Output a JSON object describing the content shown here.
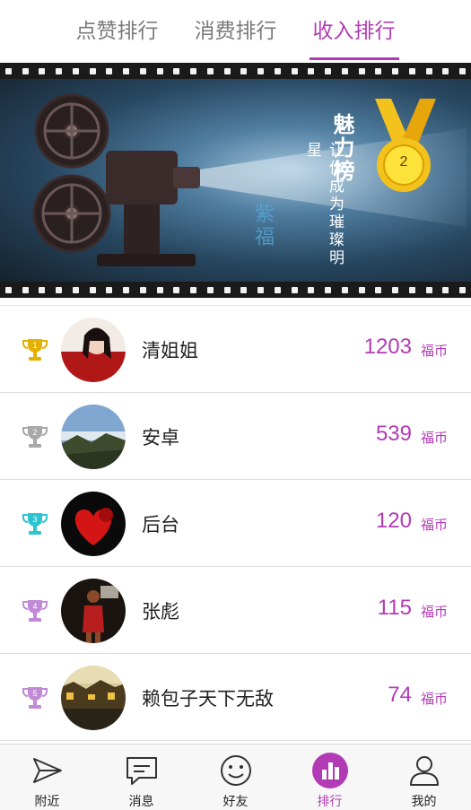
{
  "tabs": [
    {
      "label": "点赞排行",
      "active": false
    },
    {
      "label": "消费排行",
      "active": false
    },
    {
      "label": "收入排行",
      "active": true
    }
  ],
  "banner": {
    "title": "魅力榜",
    "subtitle": "让你成为璀璨明星",
    "watermark": "紫福",
    "medal_number": "2"
  },
  "ranking": [
    {
      "rank": "1",
      "name": "清姐姐",
      "amount": "1203",
      "unit": "福币",
      "trophy_color": "#e5b100",
      "avatar": "woman-in-red-photo"
    },
    {
      "rank": "2",
      "name": "安卓",
      "amount": "539",
      "unit": "福币",
      "trophy_color": "#a8a8a8",
      "avatar": "mountain-landscape-photo"
    },
    {
      "rank": "3",
      "name": "后台",
      "amount": "120",
      "unit": "福币",
      "trophy_color": "#2bc4cf",
      "avatar": "red-heart-rose-photo"
    },
    {
      "rank": "4",
      "name": "张彪",
      "amount": "115",
      "unit": "福币",
      "trophy_color": "#c28ad6",
      "avatar": "basketball-player-photo"
    },
    {
      "rank": "5",
      "name": "赖包子天下无敌",
      "amount": "74",
      "unit": "福币",
      "trophy_color": "#c28ad6",
      "avatar": "village-night-photo"
    }
  ],
  "nav": [
    {
      "label": "附近",
      "icon": "send-icon",
      "active": false
    },
    {
      "label": "消息",
      "icon": "message-icon",
      "active": false
    },
    {
      "label": "好友",
      "icon": "smile-icon",
      "active": false
    },
    {
      "label": "排行",
      "icon": "ranking-icon",
      "active": true
    },
    {
      "label": "我的",
      "icon": "profile-icon",
      "active": false
    }
  ],
  "colors": {
    "accent": "#b23bb5",
    "text": "#222222",
    "muted": "#7a7a7a"
  }
}
